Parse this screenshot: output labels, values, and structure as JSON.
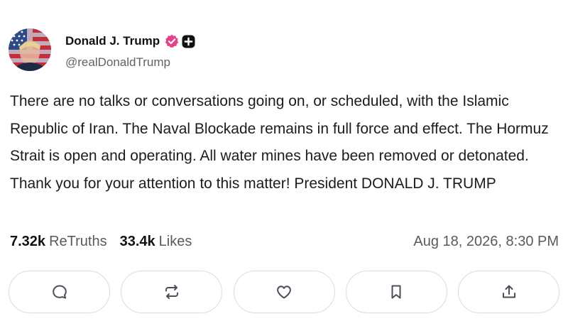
{
  "post": {
    "author": {
      "display_name": "Donald J. Trump",
      "handle": "@realDonaldTrump",
      "verified": true,
      "verified_color": "#e5408e"
    },
    "body": "There are no talks or conversations going on, or scheduled, with the Islamic Republic of Iran. The Naval Blockade remains in full force and effect. The Hormuz Strait is open and operating. All water mines have been removed or detonated. Thank you for your attention to this matter! President DONALD J. TRUMP",
    "stats": {
      "retruths_count": "7.32k",
      "retruths_label": "ReTruths",
      "likes_count": "33.4k",
      "likes_label": "Likes"
    },
    "timestamp": "Aug 18, 2026, 8:30 PM"
  },
  "actions": [
    {
      "name": "reply",
      "icon": "comment-icon"
    },
    {
      "name": "retruth",
      "icon": "repost-icon"
    },
    {
      "name": "like",
      "icon": "heart-icon"
    },
    {
      "name": "bookmark",
      "icon": "bookmark-icon"
    },
    {
      "name": "share",
      "icon": "share-icon"
    }
  ]
}
